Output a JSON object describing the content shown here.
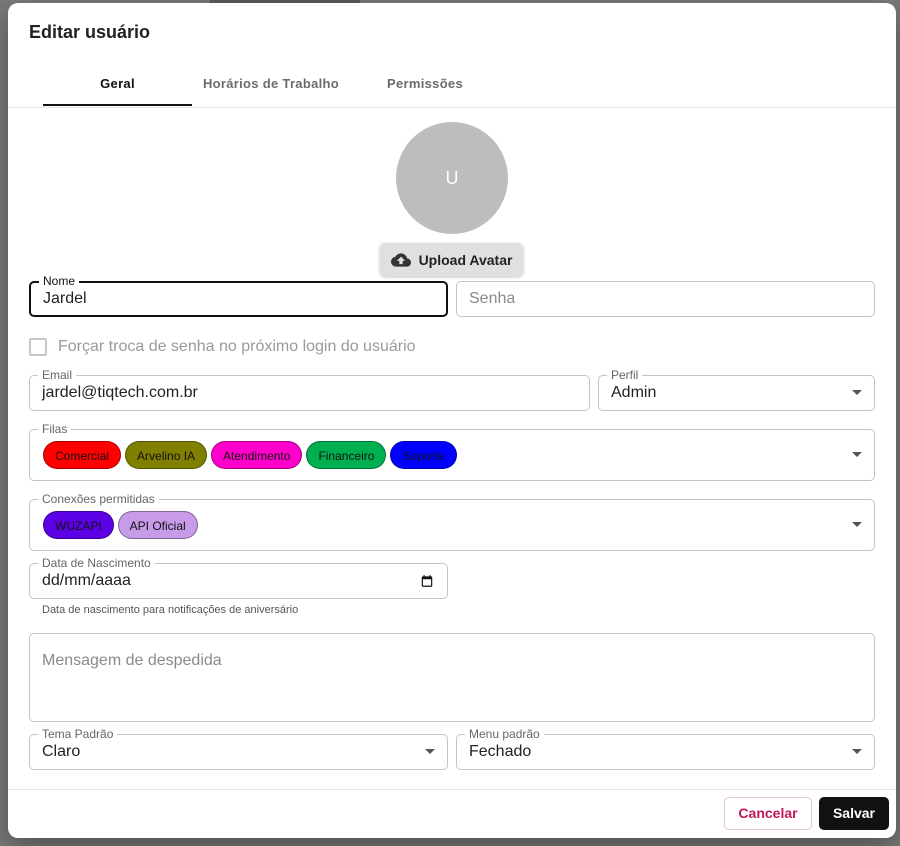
{
  "dialog": {
    "title": "Editar usuário"
  },
  "tabs": [
    {
      "label": "Geral",
      "active": true
    },
    {
      "label": "Horários de Trabalho",
      "active": false
    },
    {
      "label": "Permissões",
      "active": false
    }
  ],
  "avatar": {
    "initial": "U",
    "upload_label": "Upload Avatar",
    "upload_icon": "cloud-upload-icon"
  },
  "form": {
    "nome": {
      "label": "Nome",
      "value": "Jardel"
    },
    "senha": {
      "placeholder": "Senha"
    },
    "force_password": {
      "label": "Forçar troca de senha no próximo login do usuário",
      "checked": false
    },
    "email": {
      "label": "Email",
      "value": "jardel@tiqtech.com.br"
    },
    "perfil": {
      "label": "Perfil",
      "value": "Admin"
    },
    "filas": {
      "label": "Filas",
      "chips": [
        {
          "label": "Comercial",
          "color": "#ff0000"
        },
        {
          "label": "Arvelino IA",
          "color": "#808000"
        },
        {
          "label": "Atendimento",
          "color": "#ff00cc"
        },
        {
          "label": "Financeiro",
          "color": "#00b050"
        },
        {
          "label": "Suporte",
          "color": "#0000ff"
        }
      ]
    },
    "conexoes": {
      "label": "Conexões permitidas",
      "chips": [
        {
          "label": "WUZAPI",
          "color": "#5c00e6"
        },
        {
          "label": "API Oficial",
          "color": "#c79be8"
        }
      ]
    },
    "nascimento": {
      "label": "Data de Nascimento",
      "value": "dd/mm/aaaa",
      "helper": "Data de nascimento para notificações de aniversário"
    },
    "despedida": {
      "placeholder": "Mensagem de despedida"
    },
    "tema": {
      "label": "Tema Padrão",
      "value": "Claro"
    },
    "menu": {
      "label": "Menu padrão",
      "value": "Fechado"
    }
  },
  "footer": {
    "cancel_label": "Cancelar",
    "save_label": "Salvar"
  },
  "colors": {
    "accent": "#111111",
    "cancel": "#c2185b",
    "avatar_bg": "#bdbdbd"
  }
}
